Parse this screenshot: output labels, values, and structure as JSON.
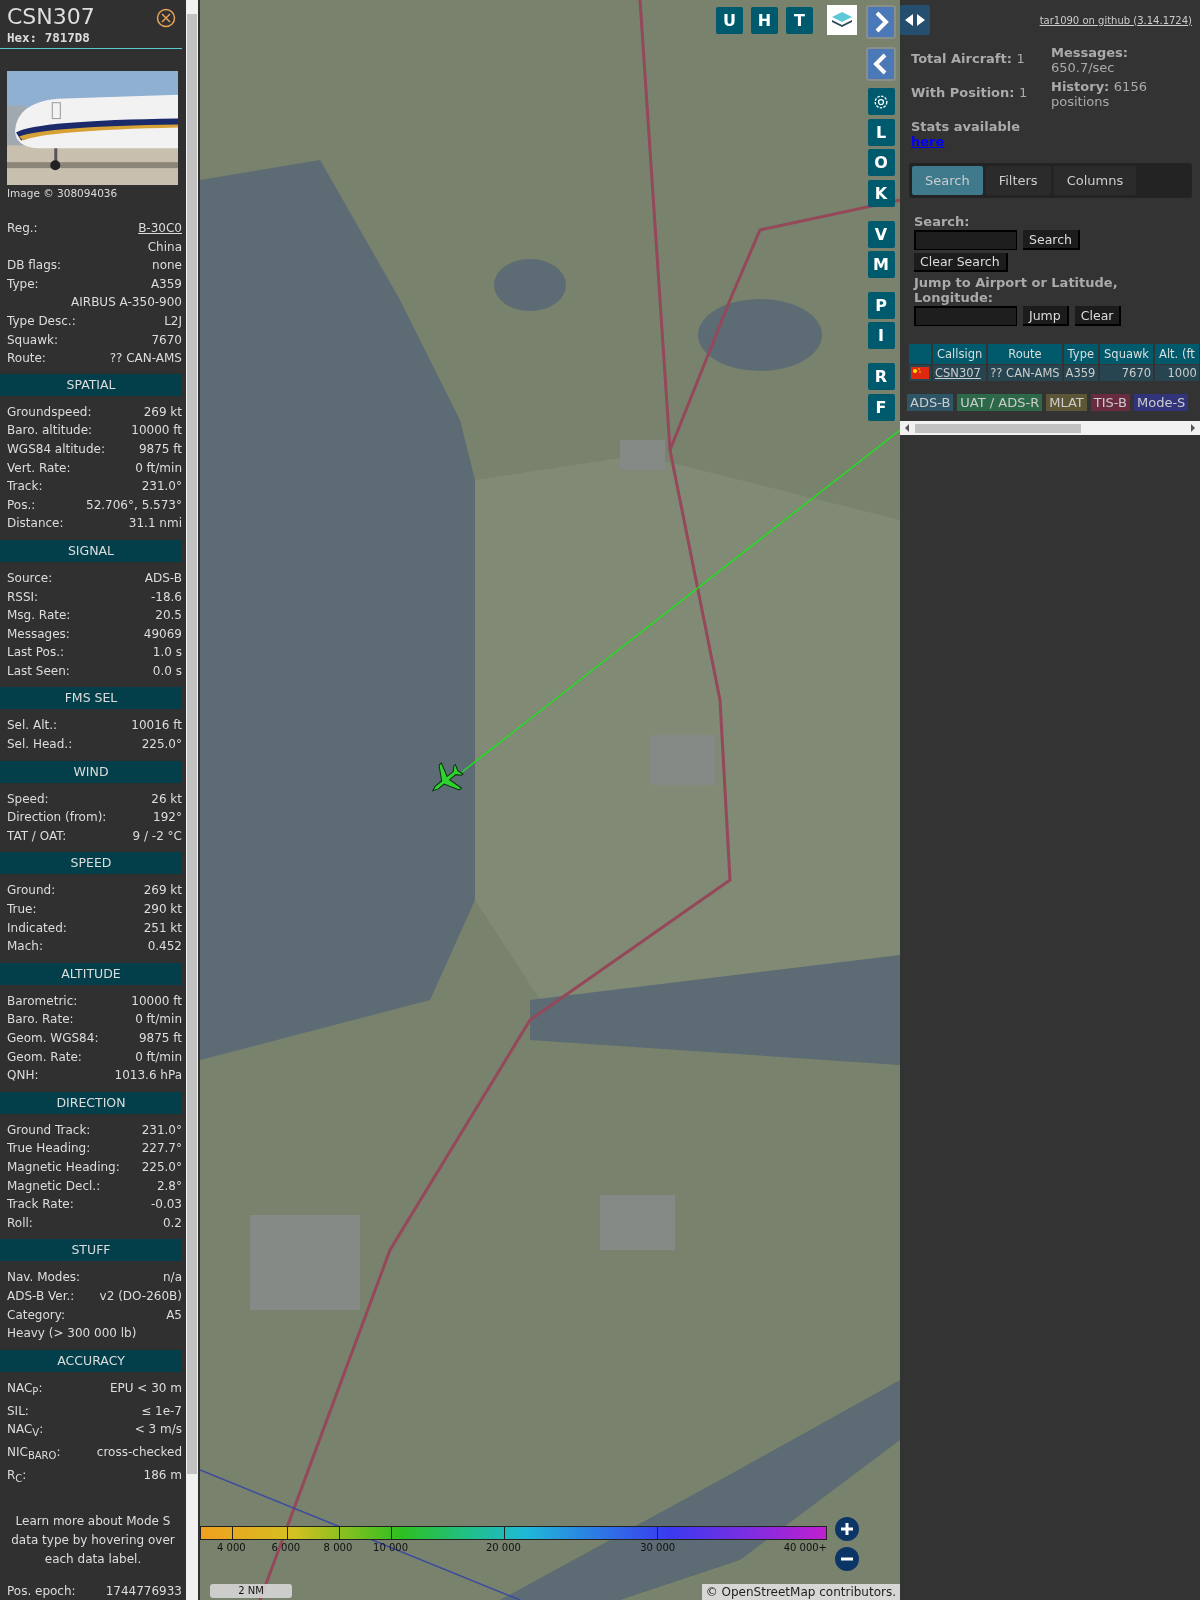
{
  "aircraft": {
    "callsign": "CSN307",
    "hex": "Hex: 7817D8",
    "photo": {
      "kind": "picture"
    },
    "photo_credit": "Image © 308094036",
    "rows": [
      {
        "kind": "link",
        "label": "Reg.:",
        "value": "B-30C0"
      },
      {
        "kind": "value",
        "value": "China"
      },
      {
        "kind": "pair",
        "label": "DB flags:",
        "value": "none"
      },
      {
        "kind": "pair",
        "label": "Type:",
        "value": "A359"
      },
      {
        "kind": "value",
        "value": "AIRBUS A-350-900"
      },
      {
        "kind": "pair",
        "label": "Type Desc.:",
        "value": "L2J"
      },
      {
        "kind": "pair",
        "label": "Squawk:",
        "value": "7670"
      },
      {
        "kind": "pair",
        "label": "Route:",
        "value": "?? CAN-AMS"
      }
    ],
    "sections": [
      {
        "title": "SPATIAL",
        "rows": [
          {
            "kind": "pair",
            "label": "Groundspeed:",
            "value": "269 kt"
          },
          {
            "kind": "pair",
            "label": "Baro. altitude:",
            "value": "10000 ft"
          },
          {
            "kind": "pair",
            "label": "WGS84 altitude:",
            "value": "9875 ft"
          },
          {
            "kind": "pair",
            "label": "Vert. Rate:",
            "value": "0 ft/min"
          },
          {
            "kind": "pair",
            "label": "Track:",
            "value": "231.0°"
          },
          {
            "kind": "pair",
            "label": "Pos.:",
            "value": "52.706°, 5.573°"
          },
          {
            "kind": "pair",
            "label": "Distance:",
            "value": "31.1 nmi"
          }
        ]
      },
      {
        "title": "SIGNAL",
        "rows": [
          {
            "kind": "pair",
            "label": "Source:",
            "value": "ADS-B"
          },
          {
            "kind": "pair",
            "label": "RSSI:",
            "value": "-18.6"
          },
          {
            "kind": "pair",
            "label": "Msg. Rate:",
            "value": "20.5"
          },
          {
            "kind": "pair",
            "label": "Messages:",
            "value": "49069"
          },
          {
            "kind": "pair",
            "label": "Last Pos.:",
            "value": "1.0 s"
          },
          {
            "kind": "pair",
            "label": "Last Seen:",
            "value": "0.0 s"
          }
        ]
      },
      {
        "title": "FMS SEL",
        "rows": [
          {
            "kind": "pair",
            "label": "Sel. Alt.:",
            "value": "10016 ft"
          },
          {
            "kind": "pair",
            "label": "Sel. Head.:",
            "value": "225.0°"
          }
        ]
      },
      {
        "title": "WIND",
        "rows": [
          {
            "kind": "pair",
            "label": "Speed:",
            "value": "26 kt"
          },
          {
            "kind": "pair",
            "label": "Direction (from):",
            "value": "192°"
          },
          {
            "kind": "pair",
            "label": "TAT / OAT:",
            "value": "9 / -2 °C"
          }
        ]
      },
      {
        "title": "SPEED",
        "rows": [
          {
            "kind": "pair",
            "label": "Ground:",
            "value": "269 kt"
          },
          {
            "kind": "pair",
            "label": "True:",
            "value": "290 kt"
          },
          {
            "kind": "pair",
            "label": "Indicated:",
            "value": "251 kt"
          },
          {
            "kind": "pair",
            "label": "Mach:",
            "value": "0.452"
          }
        ]
      },
      {
        "title": "ALTITUDE",
        "rows": [
          {
            "kind": "pair",
            "label": "Barometric:",
            "value": "10000 ft"
          },
          {
            "kind": "pair",
            "label": "Baro. Rate:",
            "value": "0 ft/min"
          },
          {
            "kind": "pair",
            "label": "Geom. WGS84:",
            "value": "9875 ft"
          },
          {
            "kind": "pair",
            "label": "Geom. Rate:",
            "value": "0 ft/min"
          },
          {
            "kind": "pair",
            "label": "QNH:",
            "value": "1013.6 hPa"
          }
        ]
      },
      {
        "title": "DIRECTION",
        "rows": [
          {
            "kind": "pair",
            "label": "Ground Track:",
            "value": "231.0°"
          },
          {
            "kind": "pair",
            "label": "True Heading:",
            "value": "227.7°"
          },
          {
            "kind": "pair",
            "label": "Magnetic Heading:",
            "value": "225.0°"
          },
          {
            "kind": "pair",
            "label": "Magnetic Decl.:",
            "value": "2.8°"
          },
          {
            "kind": "pair",
            "label": "Track Rate:",
            "value": "-0.03"
          },
          {
            "kind": "pair",
            "label": "Roll:",
            "value": "0.2"
          }
        ]
      },
      {
        "title": "STUFF",
        "rows": [
          {
            "kind": "pair",
            "label": "Nav. Modes:",
            "value": "n/a"
          },
          {
            "kind": "pair",
            "label": "ADS-B Ver.:",
            "value": "v2 (DO-260B)"
          },
          {
            "kind": "pair",
            "label": "Category:",
            "value": "A5"
          },
          {
            "kind": "text",
            "value": "Heavy (> 300 000 lb)"
          }
        ]
      },
      {
        "title": "ACCURACY",
        "rows": [
          {
            "kind": "pair",
            "label": "NAC$_{P}$:",
            "value": "EPU < 30 m"
          },
          {
            "kind": "pair",
            "label": "SIL:",
            "value": "≤ 1e-7"
          },
          {
            "kind": "pair",
            "label": "NAC$_{V}$:",
            "value": "< 3 m/s"
          },
          {
            "kind": "pair",
            "label": "NIC$_{BARO}$:",
            "value": "cross-checked"
          },
          {
            "kind": "pair",
            "label": "R$_{C}$:",
            "value": "186 m"
          }
        ]
      }
    ],
    "footer": "Learn more about Mode S data type by hovering over each data label.",
    "trailing_rows": [
      {
        "kind": "pair",
        "label": "Pos. epoch:",
        "value": "1744776933"
      }
    ]
  },
  "map": {
    "picture": {
      "kind": "picture"
    },
    "top_buttons": [
      {
        "label": "U"
      },
      {
        "label": "H"
      },
      {
        "label": "T"
      }
    ],
    "side_buttons": [
      {
        "kind": "next"
      },
      {
        "kind": "prev"
      },
      {
        "kind": "settings"
      },
      {
        "kind": "letter",
        "label": "L"
      },
      {
        "kind": "letter",
        "label": "O"
      },
      {
        "kind": "letter",
        "label": "K"
      },
      {
        "kind": "letter",
        "label": "V"
      },
      {
        "kind": "letter",
        "label": "M"
      },
      {
        "kind": "letter",
        "label": "P"
      },
      {
        "kind": "letter",
        "label": "I"
      },
      {
        "kind": "letter",
        "label": "R"
      },
      {
        "kind": "letter",
        "label": "F"
      }
    ],
    "legend_ticks": [
      "4 000",
      "6 000",
      "8 000",
      "10 000",
      "20 000",
      "30 000",
      "40 000+"
    ],
    "scale": "2 NM",
    "attribution": "© OpenStreetMap contributors."
  },
  "panel": {
    "github_link": "tar1090 on github (3.14.1724)",
    "stats_left": [
      {
        "label": "Total Aircraft:",
        "value": "1"
      },
      {
        "label": "With Position:",
        "value": "1"
      }
    ],
    "stats_right": [
      {
        "label": "Messages:",
        "value": "650.7/sec"
      },
      {
        "label": "History:",
        "value": "6156 positions"
      }
    ],
    "stats_text": "Stats available",
    "stats_link": "here",
    "tabs": [
      {
        "label": "Search",
        "selected": true
      },
      {
        "label": "Filters",
        "selected": false
      },
      {
        "label": "Columns",
        "selected": false
      }
    ],
    "search": {
      "label": "Search:",
      "button": "Search",
      "clear_button": "Clear Search",
      "jump_label": "Jump to Airport or Latitude, Longitude:",
      "jump_button": "Jump",
      "clear_jump_button": "Clear"
    },
    "table": {
      "columns": [
        "Callsign",
        "Route",
        "Type",
        "Squawk",
        "Alt. (ft"
      ],
      "rows": [
        {
          "callsign": "CSN307",
          "route": "?? CAN-AMS",
          "type": "A359",
          "squawk": "7670",
          "altitude": "1000"
        }
      ]
    },
    "sources": [
      {
        "label": "ADS-B",
        "color": "#2d5566"
      },
      {
        "label": "UAT / ADS-R",
        "color": "#2d6848"
      },
      {
        "label": "MLAT",
        "color": "#5c5636"
      },
      {
        "label": "TIS-B",
        "color": "#692b40"
      },
      {
        "label": "Mode-S",
        "color": "#32347a"
      }
    ]
  }
}
